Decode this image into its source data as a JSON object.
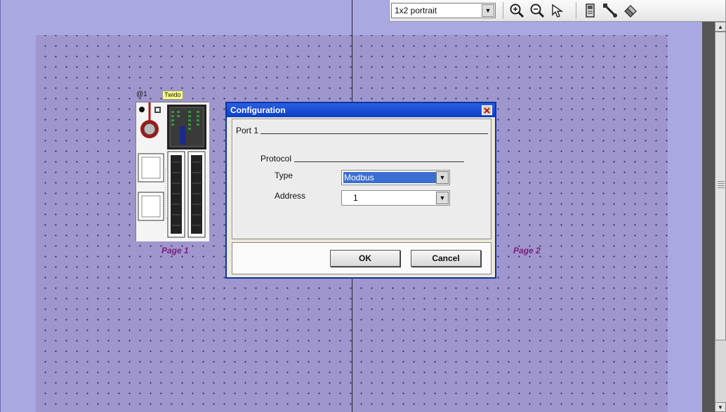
{
  "canvas": {
    "pages": [
      {
        "label": "Page 1"
      },
      {
        "label": "Page 2"
      }
    ]
  },
  "toolbar": {
    "layout_value": "1x2 portrait",
    "icons": [
      "zoom-in-icon",
      "zoom-out-icon",
      "select-arrow-icon",
      "controller-icon",
      "cable-icon",
      "eraser-icon"
    ]
  },
  "device": {
    "address_tag": "@1",
    "name_tag": "Twido"
  },
  "dialog": {
    "title": "Configuration",
    "section_label": "Port 1",
    "group_label": "Protocol",
    "type_label": "Type",
    "type_value": "Modbus",
    "address_label": "Address",
    "address_value": "1",
    "ok_label": "OK",
    "cancel_label": "Cancel"
  },
  "colors": {
    "page_area": "#9f96cd",
    "background": "#a9a8e0",
    "title_bar": "#0a3ec8",
    "page_label": "#7a1f7a",
    "selection": "#3a6fd0"
  }
}
